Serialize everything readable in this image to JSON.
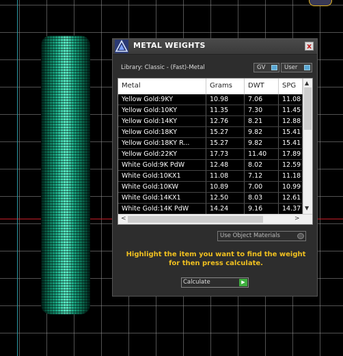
{
  "panel": {
    "title": "METAL WEIGHTS",
    "close_glyph": "x",
    "library_label": "Library: Classic - (Fast)-Metal",
    "toggles": {
      "gv": "GV",
      "user": "User"
    },
    "use_object_materials": "Use Object Materials",
    "instruction": "Highlight the item you want to find the weight for then press calculate.",
    "calculate": "Calculate"
  },
  "table": {
    "columns": [
      "Metal",
      "Grams",
      "DWT",
      "SPG"
    ],
    "rows": [
      [
        "Yellow Gold:9KY",
        "10.98",
        "7.06",
        "11.08"
      ],
      [
        "Yellow Gold:10KY",
        "11.35",
        "7.30",
        "11.45"
      ],
      [
        "Yellow Gold:14KY",
        "12.76",
        "8.21",
        "12.88"
      ],
      [
        "Yellow Gold:18KY",
        "15.27",
        "9.82",
        "15.41"
      ],
      [
        "Yellow Gold:18KY R...",
        "15.27",
        "9.82",
        "15.41"
      ],
      [
        "Yellow Gold:22KY",
        "17.73",
        "11.40",
        "17.89"
      ],
      [
        "White Gold:9K PdW",
        "12.48",
        "8.02",
        "12.59"
      ],
      [
        "White Gold:10KX1",
        "11.08",
        "7.12",
        "11.18"
      ],
      [
        "White Gold:10KW",
        "10.89",
        "7.00",
        "10.99"
      ],
      [
        "White Gold:14KX1",
        "12.50",
        "8.03",
        "12.61"
      ],
      [
        "White Gold:14K PdW",
        "14.24",
        "9.16",
        "14.37"
      ]
    ]
  },
  "colors": {
    "panel_bg": "#2d2d2d",
    "instruction": "#f0c020",
    "row_bg": "#000000",
    "ring_green": "#1aa783",
    "axis_red": "#c8202a",
    "axis_cyan": "#2a9aa6"
  },
  "icons": {
    "title_logo": "triangle-logo-icon",
    "close": "close-icon",
    "calculate": "play-arrow-icon"
  }
}
